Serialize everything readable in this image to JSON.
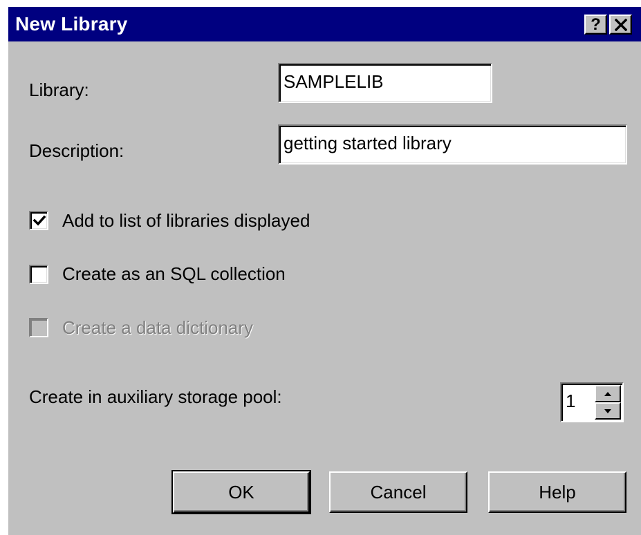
{
  "window": {
    "title": "New Library",
    "help_glyph": "?",
    "close_glyph": "✕"
  },
  "fields": {
    "library_label": "Library:",
    "library_value": "SAMPLELIB",
    "description_label": "Description:",
    "description_value": "getting started library"
  },
  "options": [
    {
      "label": "Add to list of libraries displayed",
      "checked": true,
      "enabled": true
    },
    {
      "label": "Create as an SQL collection",
      "checked": false,
      "enabled": true
    },
    {
      "label": "Create a data dictionary",
      "checked": false,
      "enabled": false
    }
  ],
  "asp": {
    "label": "Create in auxiliary storage pool:",
    "value": "1"
  },
  "buttons": {
    "ok": "OK",
    "cancel": "Cancel",
    "help": "Help"
  },
  "colors": {
    "titlebar": "#000080",
    "face": "#c0c0c0",
    "disabled_text": "#808080"
  },
  "icons": [
    "help-question-icon",
    "close-x-icon",
    "checkmark-icon",
    "spin-up-arrow-icon",
    "spin-down-arrow-icon"
  ]
}
